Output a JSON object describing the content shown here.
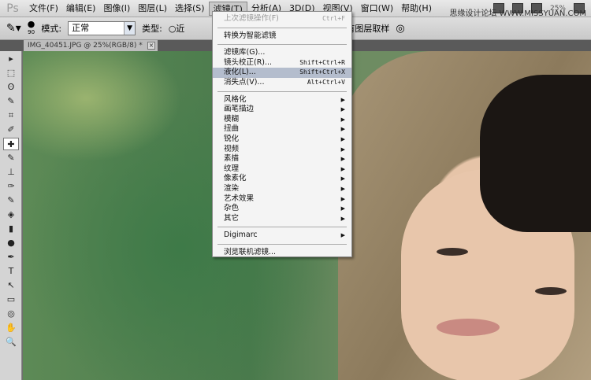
{
  "menubar": {
    "logo": "Ps",
    "items": [
      "文件(F)",
      "编辑(E)",
      "图像(I)",
      "图层(L)",
      "选择(S)",
      "滤镜(T)",
      "分析(A)",
      "3D(D)",
      "视图(V)",
      "窗口(W)",
      "帮助(H)"
    ],
    "zoom": "25%",
    "watermark": "思缘设计论坛 WWW.MISSYUAN.COM"
  },
  "options": {
    "brush_size": "90",
    "mode_label": "模式:",
    "mode_value": "正常",
    "type_label": "类型:",
    "type_value": "近",
    "sample_all": "对所有图层取样"
  },
  "tab": {
    "title": "IMG_40451.JPG @ 25%(RGB/8) *",
    "close": "×"
  },
  "tools": [
    "▸",
    "⬚",
    "ʘ",
    "✎",
    "⌗",
    "✐",
    "✚",
    "✎",
    "⊥",
    "✑",
    "✎",
    "◈",
    "▮",
    "●",
    "✒",
    "T",
    "↖",
    "▭",
    "◎",
    "✋",
    "🔍"
  ],
  "filter_menu": {
    "last": {
      "label": "上次滤镜操作(F)",
      "shortcut": "Ctrl+F"
    },
    "smart": "转换为智能滤镜",
    "group1": [
      {
        "label": "滤镜库(G)...",
        "shortcut": ""
      },
      {
        "label": "镜头校正(R)...",
        "shortcut": "Shift+Ctrl+R"
      },
      {
        "label": "液化(L)...",
        "shortcut": "Shift+Ctrl+X"
      },
      {
        "label": "消失点(V)...",
        "shortcut": "Alt+Ctrl+V"
      }
    ],
    "submenus": [
      "风格化",
      "画笔描边",
      "模糊",
      "扭曲",
      "锐化",
      "视频",
      "素描",
      "纹理",
      "像素化",
      "渲染",
      "艺术效果",
      "杂色",
      "其它"
    ],
    "digimarc": "Digimarc",
    "browse": "浏览联机滤镜..."
  }
}
